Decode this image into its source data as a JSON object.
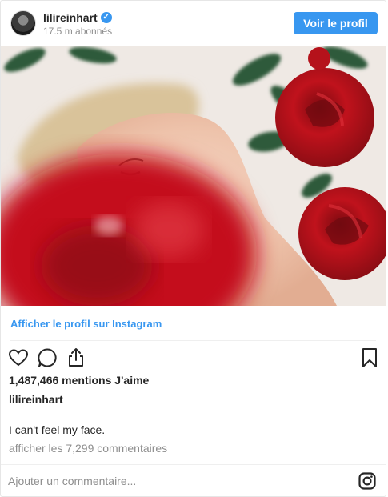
{
  "header": {
    "username": "lilireinhart",
    "verified_mark": "✓",
    "followers": "17.5 m abonnés",
    "profile_button": "Voir le profil"
  },
  "post": {
    "instagram_link": "Afficher le profil sur Instagram",
    "likes": "1,487,466 mentions J'aime",
    "caption_user": "lilireinhart",
    "caption": "I can't feel my face.",
    "comments_link": "afficher les 7,299 commentaires"
  },
  "footer": {
    "comment_placeholder": "Ajouter un commentaire..."
  },
  "icons": [
    "avatar",
    "verified-badge-icon",
    "heart-icon",
    "comment-icon",
    "share-icon",
    "bookmark-icon",
    "instagram-logo-icon"
  ],
  "colors": {
    "accent": "#3897f0",
    "text": "#262626",
    "muted": "#8e8e8e",
    "rose": "#c0121c"
  }
}
